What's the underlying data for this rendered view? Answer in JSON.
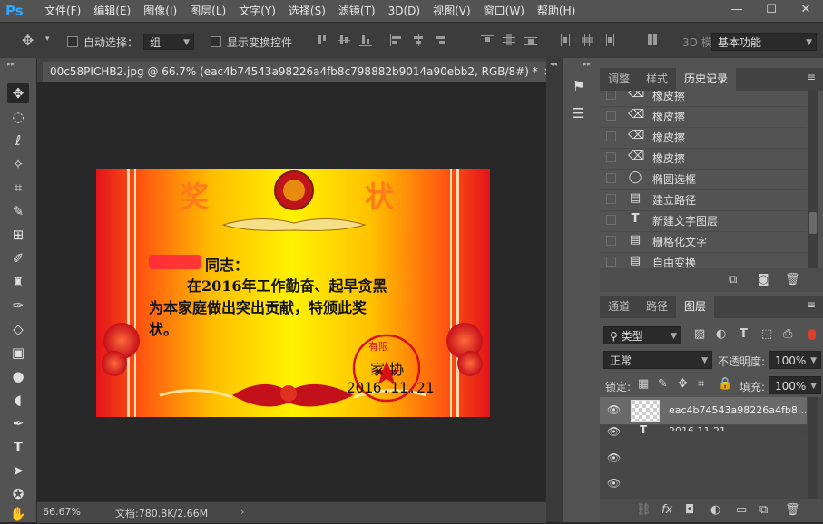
{
  "menu": {
    "logo": "Ps",
    "items": [
      "文件(F)",
      "编辑(E)",
      "图像(I)",
      "图层(L)",
      "文字(Y)",
      "选择(S)",
      "滤镜(T)",
      "3D(D)",
      "视图(V)",
      "窗口(W)",
      "帮助(H)"
    ]
  },
  "options": {
    "auto_select_label": "自动选择：",
    "auto_select_value": "组",
    "show_transform_label": "显示变换控件",
    "mode_3d_label": "3D 模",
    "workspace_value": "基本功能"
  },
  "document": {
    "tab_title": "00c58PICHB2.jpg @ 66.7% (eac4b74543a98226a4fb8c798882b9014a90ebb2, RGB/8#) *",
    "close_glyph": "×",
    "zoom": "66.67%",
    "doc_size": "文档:780.8K/2.66M"
  },
  "certificate": {
    "title_left": "奖",
    "title_right": "状",
    "line1": "同志：",
    "line2": "在2016年工作勤奋、起早贪黑",
    "line3": "为本家庭做出突出贡献，特颁此奖",
    "line4": "状。",
    "stamp_top": "有限",
    "org": "家 协",
    "date": "2016.11.21"
  },
  "history": {
    "tabs": [
      "调整",
      "样式",
      "历史记录"
    ],
    "items": [
      {
        "icon": "eraser-icon",
        "label": "橡皮擦"
      },
      {
        "icon": "eraser-icon",
        "label": "橡皮擦"
      },
      {
        "icon": "eraser-icon",
        "label": "橡皮擦"
      },
      {
        "icon": "eraser-icon",
        "label": "橡皮擦"
      },
      {
        "icon": "ellipse-marquee-icon",
        "label": "椭圆选框"
      },
      {
        "icon": "document-icon",
        "label": "建立路径"
      },
      {
        "icon": "type-icon",
        "label": "新建文字图层"
      },
      {
        "icon": "document-icon",
        "label": "栅格化文字"
      },
      {
        "icon": "document-icon",
        "label": "自由变换"
      }
    ]
  },
  "layers": {
    "tabs": [
      "通道",
      "路径",
      "图层"
    ],
    "filter_kind": "类型",
    "blend_mode": "正常",
    "opacity_label": "不透明度:",
    "opacity_value": "100%",
    "lock_label": "锁定:",
    "fill_label": "填充:",
    "fill_value": "100%",
    "layer_name": "eac4b74543a98226a4fb8...",
    "text_layer_name": "2016.11.21"
  },
  "colors": {
    "accent": "#31a8ff",
    "certificate_red": "#e21d1d",
    "certificate_yellow": "#ffe600"
  }
}
